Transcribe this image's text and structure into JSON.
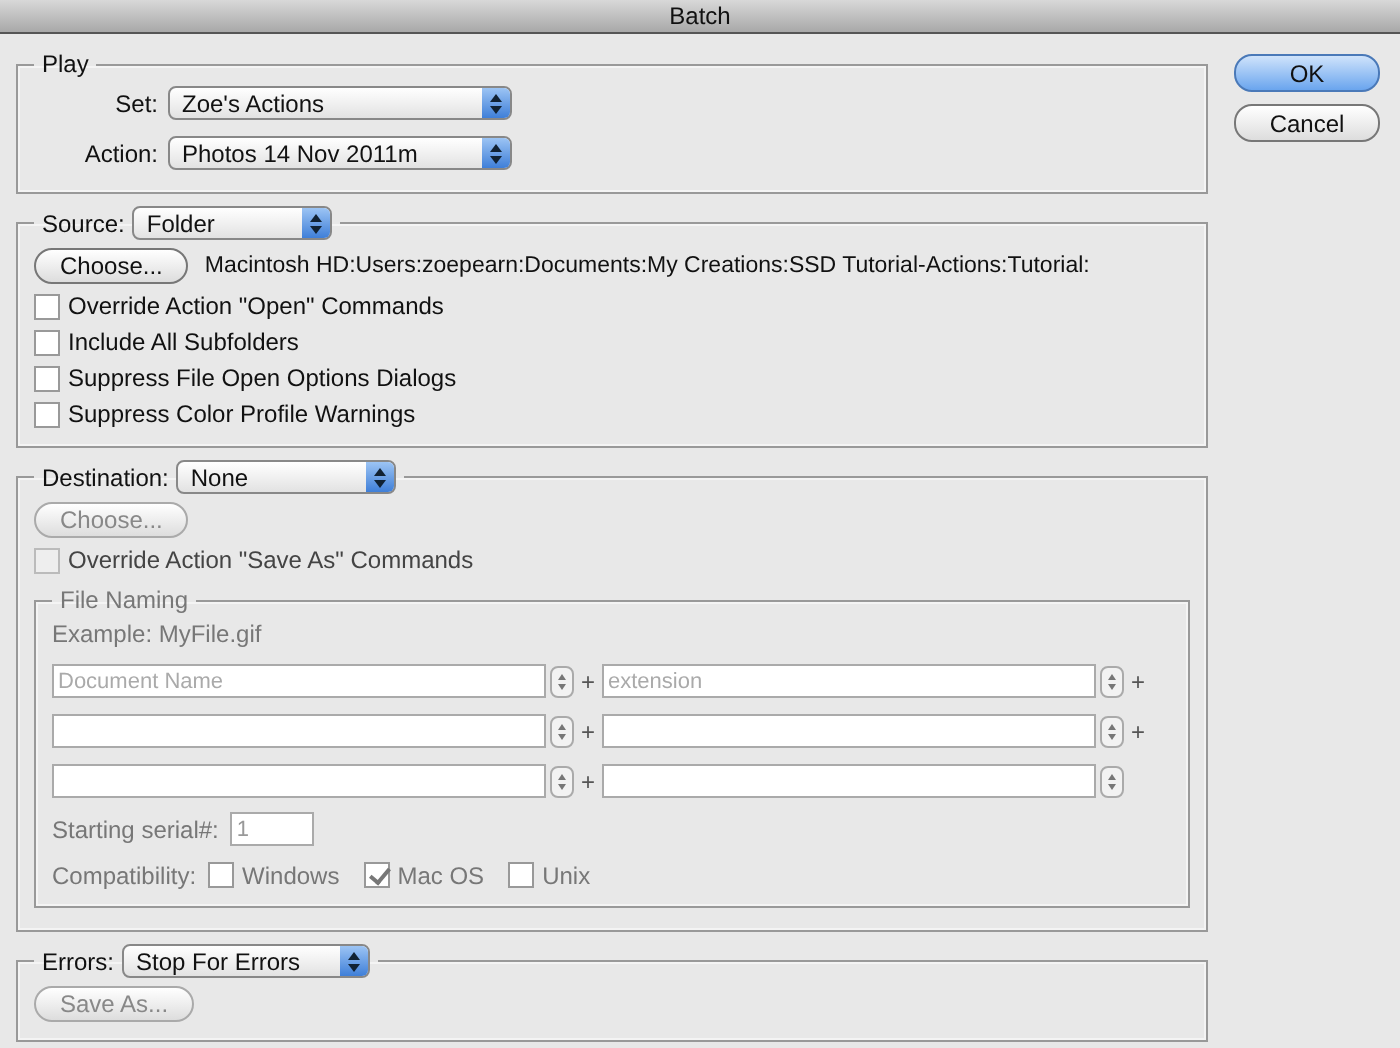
{
  "window": {
    "title": "Batch"
  },
  "play": {
    "title": "Play",
    "set": {
      "label": "Set:",
      "value": "Zoe's Actions"
    },
    "action": {
      "label": "Action:",
      "value": "Photos 14 Nov 2011m"
    }
  },
  "source": {
    "label": "Source:",
    "value": "Folder",
    "choose_button": "Choose...",
    "path": "Macintosh HD:Users:zoepearn:Documents:My Creations:SSD Tutorial-Actions:Tutorial:",
    "options": [
      {
        "label": "Override Action \"Open\" Commands",
        "checked": false
      },
      {
        "label": "Include All Subfolders",
        "checked": false
      },
      {
        "label": "Suppress File Open Options Dialogs",
        "checked": false
      },
      {
        "label": "Suppress Color Profile Warnings",
        "checked": false
      }
    ]
  },
  "destination": {
    "label": "Destination:",
    "value": "None",
    "choose_button": {
      "label": "Choose...",
      "disabled": true
    },
    "override": {
      "label": "Override Action \"Save As\" Commands",
      "checked": false,
      "disabled": true
    },
    "file_naming": {
      "title": "File Naming",
      "disabled": true,
      "example": "Example: MyFile.gif",
      "rows": [
        [
          {
            "placeholder": "Document Name",
            "plus": "+"
          },
          {
            "placeholder": "extension",
            "plus": "+"
          }
        ],
        [
          {
            "plus": "+"
          },
          {
            "plus": "+"
          }
        ],
        [
          {
            "plus": "+"
          },
          {}
        ]
      ],
      "serial": {
        "label": "Starting serial#:",
        "value": "1"
      },
      "compatibility": {
        "label": "Compatibility:",
        "options": [
          {
            "label": "Windows",
            "checked": false
          },
          {
            "label": "Mac OS",
            "checked": true
          },
          {
            "label": "Unix",
            "checked": false
          }
        ]
      }
    }
  },
  "errors": {
    "label": "Errors:",
    "value": "Stop For Errors",
    "save_as_button": {
      "label": "Save As...",
      "disabled": true
    }
  },
  "buttons": [
    {
      "label": "OK",
      "default": true
    },
    {
      "label": "Cancel",
      "default": false
    }
  ]
}
